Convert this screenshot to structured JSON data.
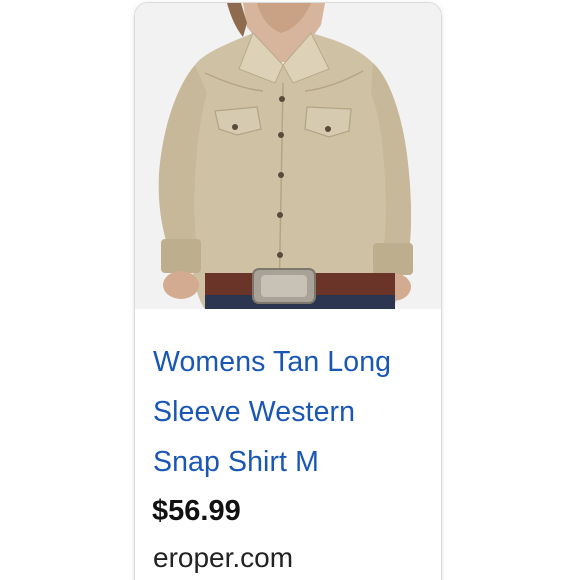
{
  "product": {
    "image_icon": "womens-tan-western-shirt-photo",
    "title_line1": "Womens Tan Long",
    "title_line2": "Sleeve Western",
    "title_line3": "Snap Shirt M",
    "price": "$56.99",
    "source": "eroper.com"
  },
  "colors": {
    "link": "#1a57b5",
    "shirt": "#cfc2a4",
    "background": "#f1f1f1"
  }
}
